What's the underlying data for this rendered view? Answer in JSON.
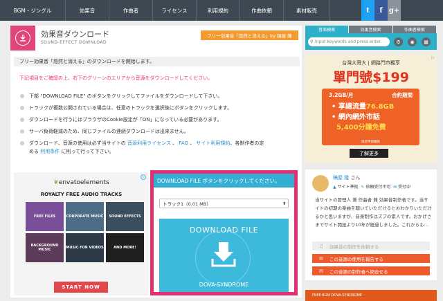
{
  "nav": {
    "items": [
      "BGM・ジングル",
      "効果音",
      "作曲者",
      "ライセンス",
      "利用規約",
      "作曲依頼",
      "素材販売"
    ],
    "social": [
      "t",
      "f",
      "g+"
    ]
  },
  "header": {
    "title": "効果音ダウンロード",
    "subtitle": "SOUND-EFFECT DOWNLOAD",
    "badge": "フリー効果音「怨然と消える」by 稿屋 隆"
  },
  "notice": "フリー効果音「怨然と消える」のダウンロードを開始します。",
  "warning": "下記項目をご確認の上、右下のグリーンのエリアから音源をダウンロードしてください。",
  "info": [
    "下部 \"DOWNLOAD FILE\" のボタンをクリックしてファイルをダウンロードして下さい。",
    "トラックが複数公開されている場合は、任意のトラックを選択後にボタンをクリックします。",
    "ダウンロードを行うにはブラウザのCookie設定が「ON」になっている必要があります。",
    "サーバ負荷軽減のため、同じファイルの連続ダウンロードは出来ません。"
  ],
  "info_last": {
    "a": "ダウンロード、音源の使用は必ず当サイトの",
    "link1": "音源利用ライセンス",
    "b": "、",
    "link2": "FAQ",
    "c": "、",
    "link3": "サイト利用規約",
    "d": "、各制作者の定",
    "e": "める",
    "link4": "利用条件",
    "f": "に則って行って下さい。"
  },
  "envato": {
    "logo": "envatoelements",
    "sub": "ROYALTY FREE AUDIO TRACKS",
    "tiles": [
      "FREE FILES",
      "CORPORATE MUSIC",
      "SOUND EFFECTS",
      "BACKGROUND MUSIC",
      "MUSIC FOR VIDEOS",
      "AND MORE!"
    ],
    "cta": "START NOW"
  },
  "download": {
    "header": "DOWNLOAD FILE ボタンをクリックしてください。",
    "track": "トラック1（0.01 MB）",
    "button_title": "DOWNLOAD FILE",
    "button_sub": "DOVA-SYNDROME"
  },
  "sidebar": {
    "tabs": [
      "音楽検索",
      "効果音検索",
      "作曲者検索"
    ],
    "search_placeholder": "Input keywords and press enter.",
    "buttons": [
      "⚙",
      "◉",
      "▦"
    ]
  },
  "ad": {
    "brand": "台灣大哥大 | 網路門市獨享",
    "headline": "單門號$199",
    "plan_left": "3.2GB/月",
    "plan_right": "合約期間",
    "bullets": [
      "享總流量",
      "76.8GB",
      "網內網外市話",
      "5,400分鐘免費"
    ],
    "note": "限新申辦攜碼",
    "cta": "了解更多"
  },
  "profile": {
    "name": "稿屋 隆",
    "suffix": "さん",
    "flags": [
      "サイト準拠",
      "依頼受付不可",
      "受付中"
    ],
    "bio": "当サイトの管理人 兼 作曲者 兼 効果音制作者です。当サイトの初期の楽曲を聴いていただけるとおわかりいただけるかと思いますが、音楽制作はズブの素人です。おかげさまでサイト開設より10年が経過しました。これからも…",
    "btn_disabled": "効果音の制作を依頼する",
    "btn_report": "この音源の使用を報告する",
    "btn_contact": "この音源の制作者へ問合せる"
  },
  "bottom_ad": "FREE BGM DOVA-SYNDROME"
}
